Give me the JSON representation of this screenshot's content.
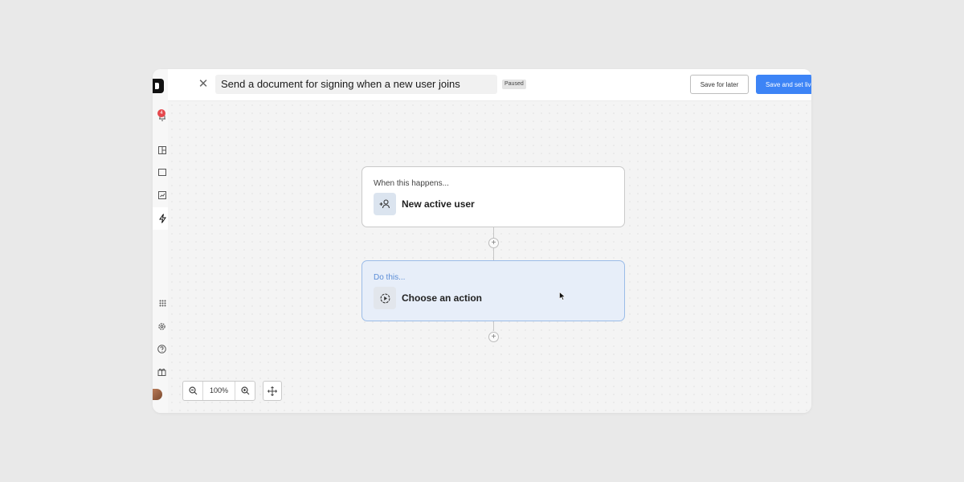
{
  "header": {
    "title": "Send a document for signing when a new user joins",
    "status": "Paused",
    "save_later_label": "Save for later",
    "save_live_label": "Save and set live"
  },
  "sidebar": {
    "notification_count": "4",
    "icons": [
      "logo-icon",
      "bell-icon",
      "layout-icon",
      "document-icon",
      "report-icon",
      "lightning-icon",
      "apps-grid-icon",
      "gear-icon",
      "help-icon",
      "gift-icon"
    ],
    "active_item": "lightning-icon"
  },
  "workflow": {
    "trigger": {
      "label": "When this happens...",
      "title": "New active user",
      "icon": "user-plus-icon"
    },
    "action": {
      "label": "Do this...",
      "title": "Choose an action",
      "icon": "play-circle-icon"
    }
  },
  "zoom": {
    "value": "100%"
  },
  "colors": {
    "primary": "#3d84f6",
    "action_card_bg": "#e7eef9",
    "action_card_border": "#9bbce8",
    "badge": "#e5484d",
    "chat": "#1f6fb8"
  }
}
